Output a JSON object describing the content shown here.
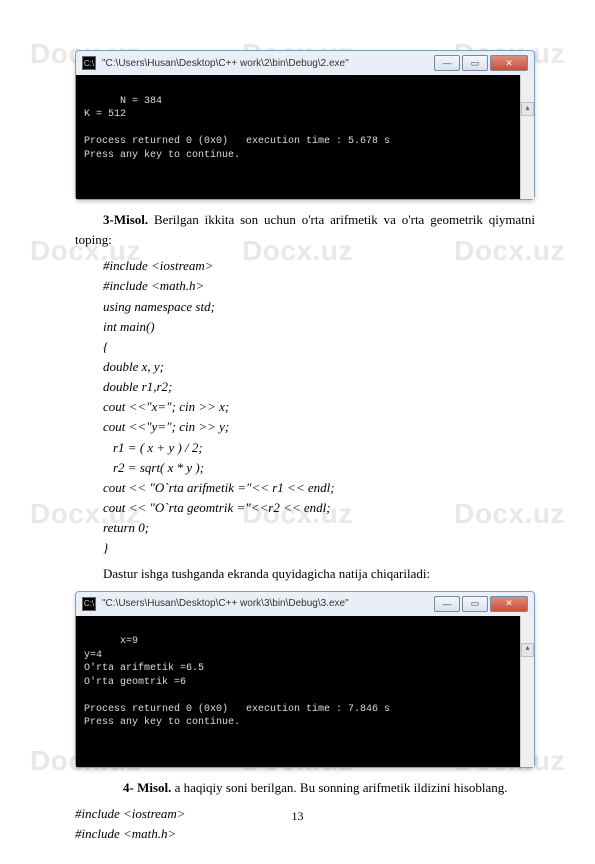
{
  "watermarks": {
    "text": "Docx.uz"
  },
  "console1": {
    "title": "\"C:\\Users\\Husan\\Desktop\\C++ work\\2\\bin\\Debug\\2.exe\"",
    "body": "N = 384\nK = 512\n\nProcess returned 0 (0x0)   execution time : 5.678 s\nPress any key to continue."
  },
  "paragraph1": {
    "label": "3-Misol.",
    "text": " Berilgan ikkita son uchun o'rta arifmetik va o'rta geometrik qiymatni toping:"
  },
  "code1": {
    "l1": "#include <iostream>",
    "l2": "#include <math.h>",
    "l3": "using namespace std;",
    "l4": "int main()",
    "l5": "{",
    "l6": " double x, y;",
    "l7": " double r1,r2;",
    "l8": " cout <<\"x=\"; cin >> x;",
    "l9": " cout <<\"y=\"; cin >> y;",
    "l10": "  r1 = ( x + y ) / 2;",
    "l11": "  r2 = sqrt( x * y );",
    "l12": " cout << \"O`rta arifmetik =\"<< r1 << endl;",
    "l13": " cout << \"O`rta geomtrik =\"<<r2 << endl;",
    "l14": " return 0;",
    "l15": "}"
  },
  "paragraph2": "Dastur ishga tushganda ekranda quyidagicha natija chiqariladi:",
  "console2": {
    "title": "\"C:\\Users\\Husan\\Desktop\\C++ work\\3\\bin\\Debug\\3.exe\"",
    "body": "x=9\ny=4\nO'rta arifmetik =6.5\nO'rta geomtrik =6\n\nProcess returned 0 (0x0)   execution time : 7.846 s\nPress any key to continue."
  },
  "paragraph3": {
    "label": "4- Misol.",
    "text": " a haqiqiy soni berilgan. Bu sonning arifmetik ildizini hisoblang."
  },
  "code2": {
    "l1": "#include <iostream>",
    "l2": "#include <math.h>"
  },
  "pageNumber": "13"
}
